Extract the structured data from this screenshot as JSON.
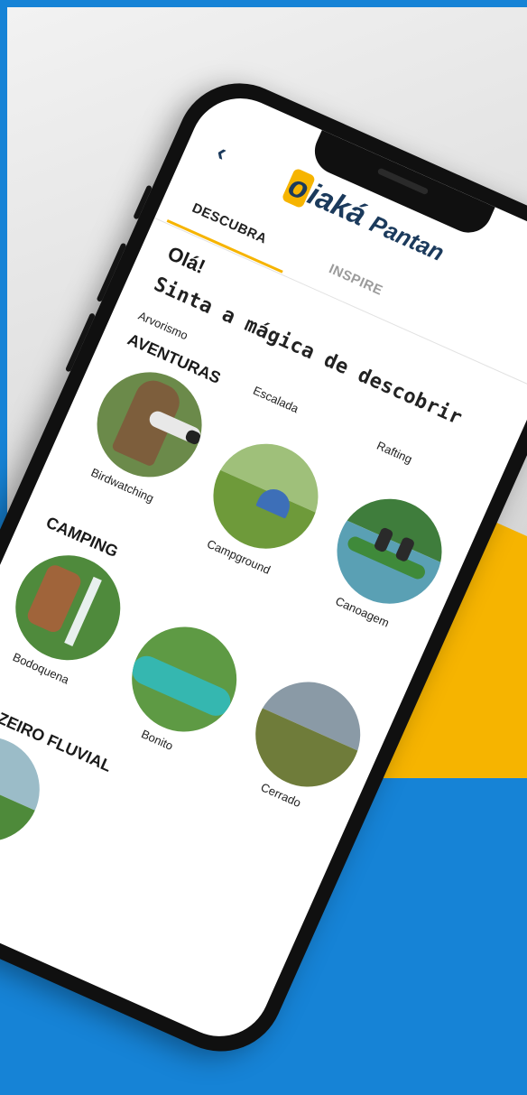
{
  "app": {
    "back_icon": "chevron-left-icon",
    "logo_mark": "o",
    "logo_text": "iaká",
    "logo_rest": "Pantan"
  },
  "tabs": [
    {
      "label": "DESCUBRA",
      "active": true
    },
    {
      "label": "INSPIRE",
      "active": false
    }
  ],
  "greeting": "Olá!",
  "tagline": "Sinta a mágica de descobrir",
  "sections": [
    {
      "title": "AVENTURAS",
      "preceding_labels": [
        "Arvorismo",
        "Escalada",
        "Rafting"
      ],
      "items": [
        {
          "label": "Birdwatching",
          "image": "photographer-with-telephoto-lens"
        },
        {
          "label": "Campground",
          "image": "tent-in-green-field"
        },
        {
          "label": "Canoagem",
          "image": "canoe-on-river"
        }
      ]
    },
    {
      "title": "CAMPING",
      "items": [
        {
          "label": "Bodoquena",
          "image": "waterfall-canyon"
        },
        {
          "label": "Bonito",
          "image": "aerial-turquoise-river"
        },
        {
          "label": "Cerrado",
          "image": "savanna-landscape"
        }
      ]
    },
    {
      "title": "CRUZEIRO FLUVIAL",
      "items": []
    }
  ],
  "colors": {
    "frame_blue": "#1683d6",
    "accent_yellow": "#f6b400",
    "brand_navy": "#1b3a5c"
  }
}
